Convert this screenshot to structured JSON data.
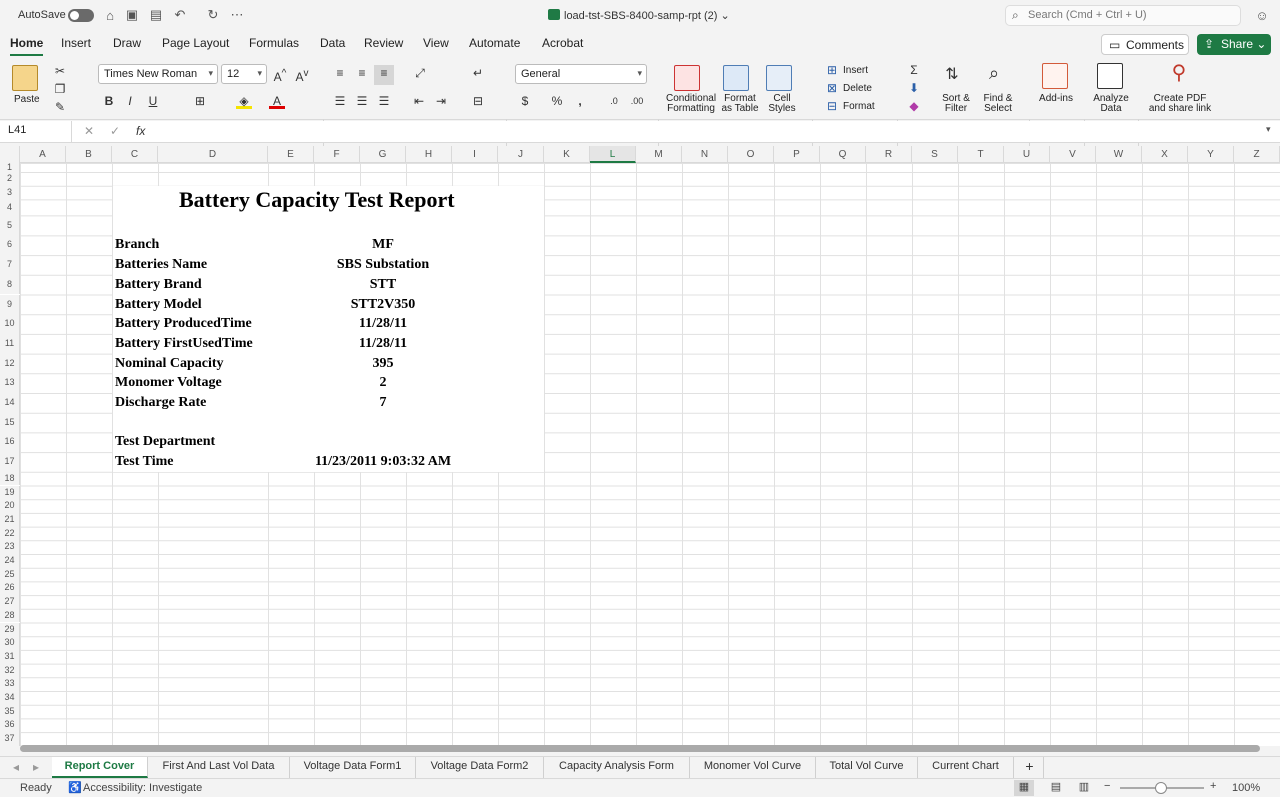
{
  "titlebar": {
    "autosave": "AutoSave",
    "filename": "load-tst-SBS-8400-samp-rpt (2)",
    "search_placeholder": "Search (Cmd + Ctrl + U)"
  },
  "menu": {
    "tabs": [
      "Home",
      "Insert",
      "Draw",
      "Page Layout",
      "Formulas",
      "Data",
      "Review",
      "View",
      "Automate",
      "Acrobat"
    ],
    "comments": "Comments",
    "share": "Share"
  },
  "ribbon": {
    "paste": "Paste",
    "font_name": "Times New Roman",
    "font_size": "12",
    "number_format": "General",
    "conditional": "Conditional",
    "formatting": "Formatting",
    "format_as": "Format",
    "as_table": "as Table",
    "cell": "Cell",
    "styles": "Styles",
    "insert": "Insert",
    "delete": "Delete",
    "format": "Format",
    "sort": "Sort &",
    "filter": "Filter",
    "find": "Find &",
    "select": "Select",
    "addins": "Add-ins",
    "analyze": "Analyze",
    "data": "Data",
    "createpdf": "Create PDF",
    "sharelink": "and share link",
    "bold": "B",
    "italic": "I",
    "underline": "U"
  },
  "formula": {
    "cell_ref": "L41",
    "fx": "fx"
  },
  "columns": [
    "A",
    "B",
    "C",
    "D",
    "E",
    "F",
    "G",
    "H",
    "I",
    "J",
    "K",
    "L",
    "M",
    "N",
    "O",
    "P",
    "Q",
    "R",
    "S",
    "T",
    "U",
    "V",
    "W",
    "X",
    "Y",
    "Z"
  ],
  "active_column": "L",
  "rows": [
    "1",
    "2",
    "3",
    "4",
    "5",
    "6",
    "7",
    "8",
    "9",
    "10",
    "11",
    "12",
    "13",
    "14",
    "15",
    "16",
    "17",
    "18",
    "19",
    "20",
    "21",
    "22",
    "23",
    "24",
    "25",
    "26",
    "27",
    "28",
    "29",
    "30",
    "31",
    "32",
    "33",
    "34",
    "35",
    "36",
    "37"
  ],
  "report": {
    "title": "Battery Capacity Test Report",
    "fields": [
      {
        "label": "Branch",
        "value": "MF"
      },
      {
        "label": "Batteries Name",
        "value": "SBS Substation"
      },
      {
        "label": "Battery Brand",
        "value": "STT"
      },
      {
        "label": "Battery Model",
        "value": "STT2V350"
      },
      {
        "label": "Battery ProducedTime",
        "value": "11/28/11"
      },
      {
        "label": "Battery FirstUsedTime",
        "value": "11/28/11"
      },
      {
        "label": "Nominal Capacity",
        "value": "395"
      },
      {
        "label": "Monomer Voltage",
        "value": "2"
      },
      {
        "label": "Discharge Rate",
        "value": "7"
      }
    ],
    "test_department": "Test Department",
    "test_time_label": "Test Time",
    "test_time_value": "11/23/2011 9:03:32 AM"
  },
  "sheets": [
    "Report Cover",
    "First And Last Vol Data",
    "Voltage Data Form1",
    "Voltage Data Form2",
    "Capacity Analysis Form",
    "Monomer Vol Curve",
    "Total Vol Curve",
    "Current Chart"
  ],
  "active_sheet": "Report Cover",
  "status": {
    "ready": "Ready",
    "accessibility": "Accessibility: Investigate",
    "zoom": "100%"
  }
}
